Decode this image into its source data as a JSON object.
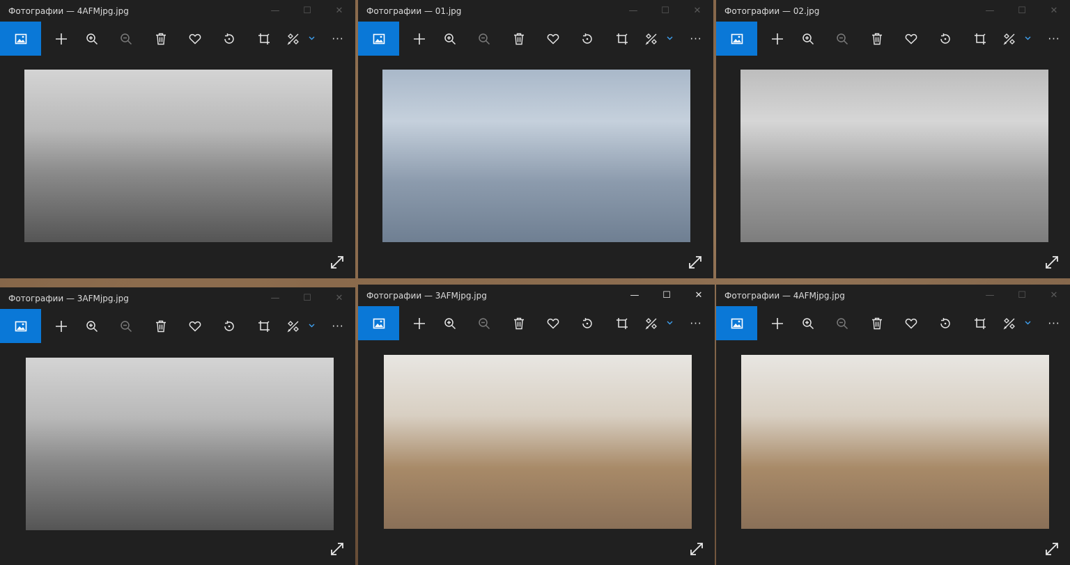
{
  "windows": [
    {
      "title": "Фотографии — 4AFMjpg.jpg",
      "image": "grayscale interior render",
      "active": false
    },
    {
      "title": "Фотографии — 01.jpg",
      "image": "blue clay interior render",
      "active": false
    },
    {
      "title": "Фотографии — 02.jpg",
      "image": "gray clay interior render",
      "active": false
    },
    {
      "title": "Фотографии — 3AFMjpg.jpg",
      "image": "grayscale living room render",
      "active": false
    },
    {
      "title": "Фотографии — 3AFMjpg.jpg",
      "image": "color living room render",
      "active": true
    },
    {
      "title": "Фотографии — 4AFMjpg.jpg",
      "image": "color kitchen render",
      "active": false
    }
  ],
  "toolbar": {
    "icons": [
      "image-home-icon",
      "plus-icon",
      "zoom-in-icon",
      "zoom-out-icon",
      "trash-icon",
      "heart-icon",
      "rotate-icon",
      "crop-icon",
      "edit-icon",
      "chevron-down-icon",
      "more-icon"
    ],
    "more_label": "···"
  },
  "window_controls": {
    "minimize": "—",
    "maximize": "☐",
    "close": "✕"
  },
  "colors": {
    "accent": "#0a78d7",
    "window_bg": "#202020"
  }
}
